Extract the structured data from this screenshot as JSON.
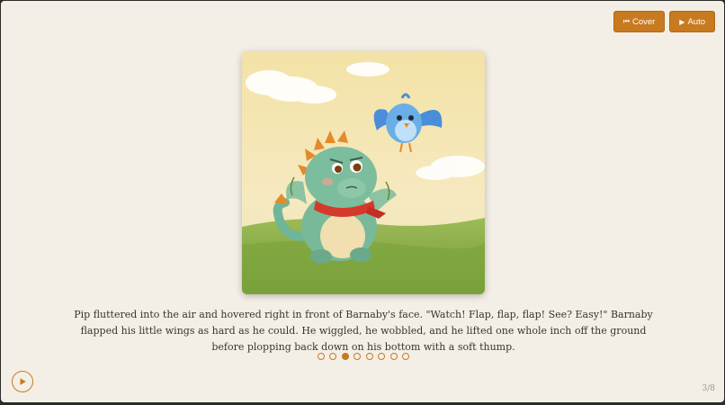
{
  "toolbar": {
    "cover_label": "Cover",
    "auto_label": "Auto",
    "cover_icon": "skip-to-start-icon",
    "auto_icon": "play-icon"
  },
  "page": {
    "text": "Pip fluttered into the air and hovered right in front of Barnaby's face. \"Watch! Flap, flap, flap! See? Easy!\" Barnaby flapped his little wings as hard as he could. He wiggled, he wobbled, and he lifted one whole inch off the ground before plopping back down on his bottom with a soft thump.",
    "counter": "3/8",
    "current": 3,
    "total": 8
  },
  "colors": {
    "accent": "#c77a1f",
    "background": "#f4efe6",
    "text": "#3b3328"
  }
}
